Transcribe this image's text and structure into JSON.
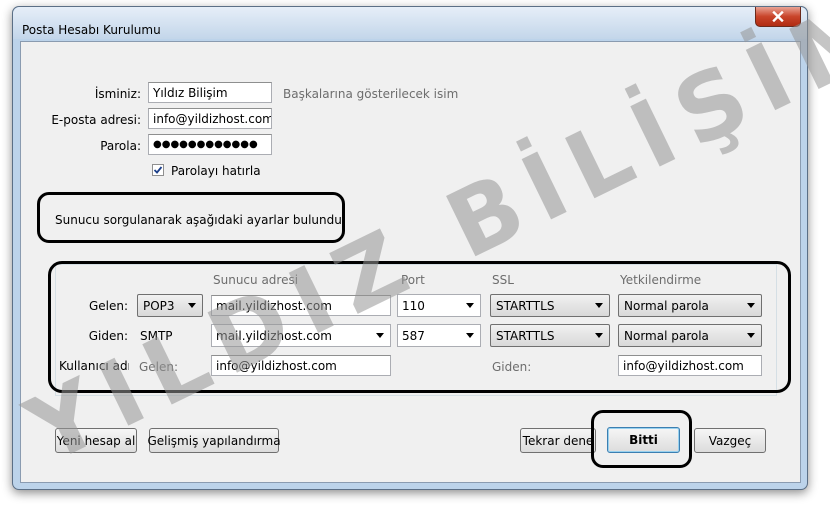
{
  "window": {
    "title": "Posta Hesabı Kurulumu"
  },
  "form": {
    "name_label": "İsminiz:",
    "name_value": "Yıldız Bilişim",
    "name_hint": "Başkalarına gösterilecek isim",
    "email_label": "E-posta adresi:",
    "email_value": "info@yildizhost.com",
    "password_label": "Parola:",
    "password_value": "●●●●●●●●●●●●",
    "remember_label": "Parolayı hatırla",
    "remember_checked": true
  },
  "status_message": "Sunucu sorgulanarak aşağıdaki ayarlar bulundu",
  "server_table": {
    "headers": {
      "server": "Sunucu adresi",
      "port": "Port",
      "ssl": "SSL",
      "auth": "Yetkilendirme"
    },
    "incoming": {
      "label": "Gelen:",
      "protocol": "POP3",
      "server": "mail.yildizhost.com",
      "port": "110",
      "ssl": "STARTTLS",
      "auth": "Normal parola"
    },
    "outgoing": {
      "label": "Giden:",
      "protocol": "SMTP",
      "server": "mail.yildizhost.com",
      "port": "587",
      "ssl": "STARTTLS",
      "auth": "Normal parola"
    },
    "username": {
      "label": "Kullanıcı adı:",
      "incoming_label": "Gelen:",
      "incoming_value": "info@yildizhost.com",
      "outgoing_label": "Giden:",
      "outgoing_value": "info@yildizhost.com"
    }
  },
  "buttons": {
    "new_account": "Yeni hesap al",
    "advanced": "Gelişmiş yapılandırma",
    "retest": "Tekrar dene",
    "done": "Bitti",
    "cancel": "Vazgeç"
  },
  "watermark": "YILDIZ BİLİŞİM"
}
